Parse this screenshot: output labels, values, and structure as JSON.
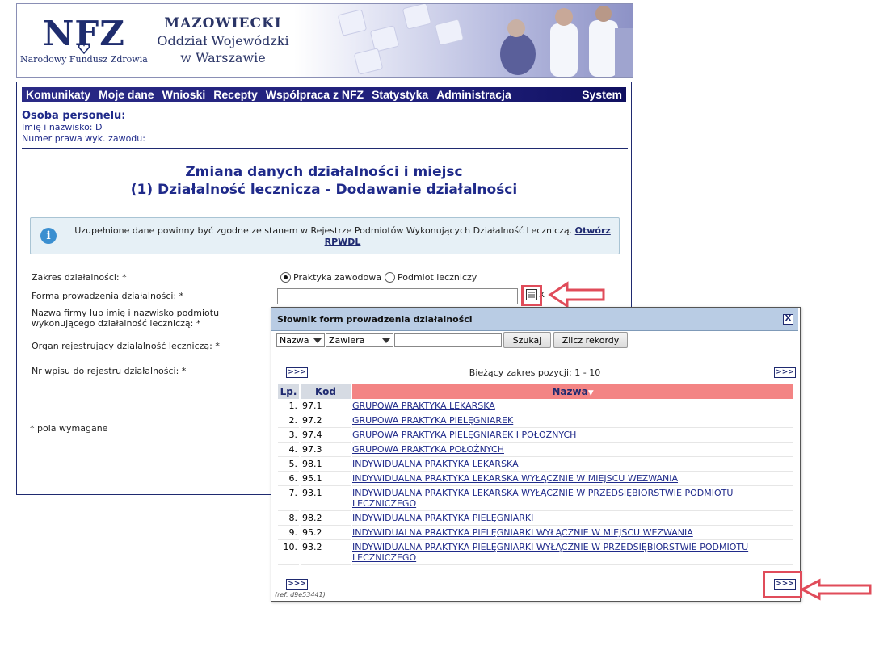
{
  "banner": {
    "logo": "NFZ",
    "logo_subtitle": "Narodowy Fundusz Zdrowia",
    "branch_line1": "MAZOWIECKI",
    "branch_line2": "Oddział Wojewódzki",
    "branch_line3": "w Warszawie"
  },
  "menu": {
    "items": [
      "Komunikaty",
      "Moje dane",
      "Wnioski",
      "Recepty",
      "Współpraca z NFZ",
      "Statystyka",
      "Administracja"
    ],
    "system": "System"
  },
  "person": {
    "title": "Osoba personelu:",
    "name_label": "Imię i nazwisko: D",
    "license_label": "Numer prawa wyk. zawodu:"
  },
  "page": {
    "title_line1": "Zmiana danych działalności i miejsc",
    "title_line2": "(1) Działalność lecznicza - Dodawanie działalności"
  },
  "info": {
    "text": "Uzupełnione dane powinny być zgodne ze stanem w Rejestrze Podmiotów Wykonujących Działalność Leczniczą.",
    "link": "Otwórz RPWDL"
  },
  "form": {
    "zakres_label": "Zakres działalności: *",
    "radio1_label": "Praktyka zawodowa",
    "radio2_label": "Podmiot leczniczy",
    "forma_label": "Forma prowadzenia działalności: *",
    "nazwa_label_line1": "Nazwa firmy lub imię i nazwisko podmiotu",
    "nazwa_label_line2": "wykonującego działalność leczniczą: *",
    "organ_label": "Organ rejestrujący działalność leczniczą: *",
    "nr_label": "Nr wpisu do rejestru działalności: *",
    "clear": "x",
    "required_note": "* pola wymagane"
  },
  "popup": {
    "title": "Słownik form prowadzenia działalności",
    "close": "X",
    "field_select": "Nazwa",
    "operator_select": "Zawiera",
    "search_button": "Szukaj",
    "count_button": "Zlicz rekordy",
    "nav_label": ">>>",
    "range": "Bieżący zakres pozycji: 1 - 10",
    "headers": {
      "lp": "Lp.",
      "kod": "Kod",
      "nazwa": "Nazwa"
    },
    "sort_indicator": "▼",
    "rows": [
      {
        "lp": "1.",
        "kod": "97.1",
        "nazwa": "GRUPOWA PRAKTYKA LEKARSKA"
      },
      {
        "lp": "2.",
        "kod": "97.2",
        "nazwa": "GRUPOWA PRAKTYKA PIELĘGNIAREK"
      },
      {
        "lp": "3.",
        "kod": "97.4",
        "nazwa": "GRUPOWA PRAKTYKA PIELĘGNIAREK I POŁOŻNYCH"
      },
      {
        "lp": "4.",
        "kod": "97.3",
        "nazwa": "GRUPOWA PRAKTYKA POŁOŻNYCH"
      },
      {
        "lp": "5.",
        "kod": "98.1",
        "nazwa": "INDYWIDUALNA PRAKTYKA LEKARSKA"
      },
      {
        "lp": "6.",
        "kod": "95.1",
        "nazwa": "INDYWIDUALNA PRAKTYKA LEKARSKA WYŁĄCZNIE W MIEJSCU WEZWANIA"
      },
      {
        "lp": "7.",
        "kod": "93.1",
        "nazwa": "INDYWIDUALNA PRAKTYKA LEKARSKA WYŁĄCZNIE W PRZEDSIĘBIORSTWIE PODMIOTU LECZNICZEGO"
      },
      {
        "lp": "8.",
        "kod": "98.2",
        "nazwa": "INDYWIDUALNA PRAKTYKA PIELĘGNIARKI"
      },
      {
        "lp": "9.",
        "kod": "95.2",
        "nazwa": "INDYWIDUALNA PRAKTYKA PIELĘGNIARKI WYŁĄCZNIE W MIEJSCU WEZWANIA"
      },
      {
        "lp": "10.",
        "kod": "93.2",
        "nazwa": "INDYWIDUALNA PRAKTYKA PIELĘGNIARKI WYŁĄCZNIE W PRZEDSIĘBIORSTWIE PODMIOTU LECZNICZEGO"
      }
    ],
    "ref": "(ref. d9e53441)"
  },
  "colors": {
    "menu_bg": "#1f1f7a",
    "accent_blue": "#1f2a8a",
    "popup_title_bg": "#b9cce4",
    "sorted_header": "#f38484",
    "highlight_red": "#e04c5a"
  },
  "icons": {
    "info": "info-icon",
    "dictionary": "list-icon",
    "arrow": "red-arrow-icon"
  }
}
